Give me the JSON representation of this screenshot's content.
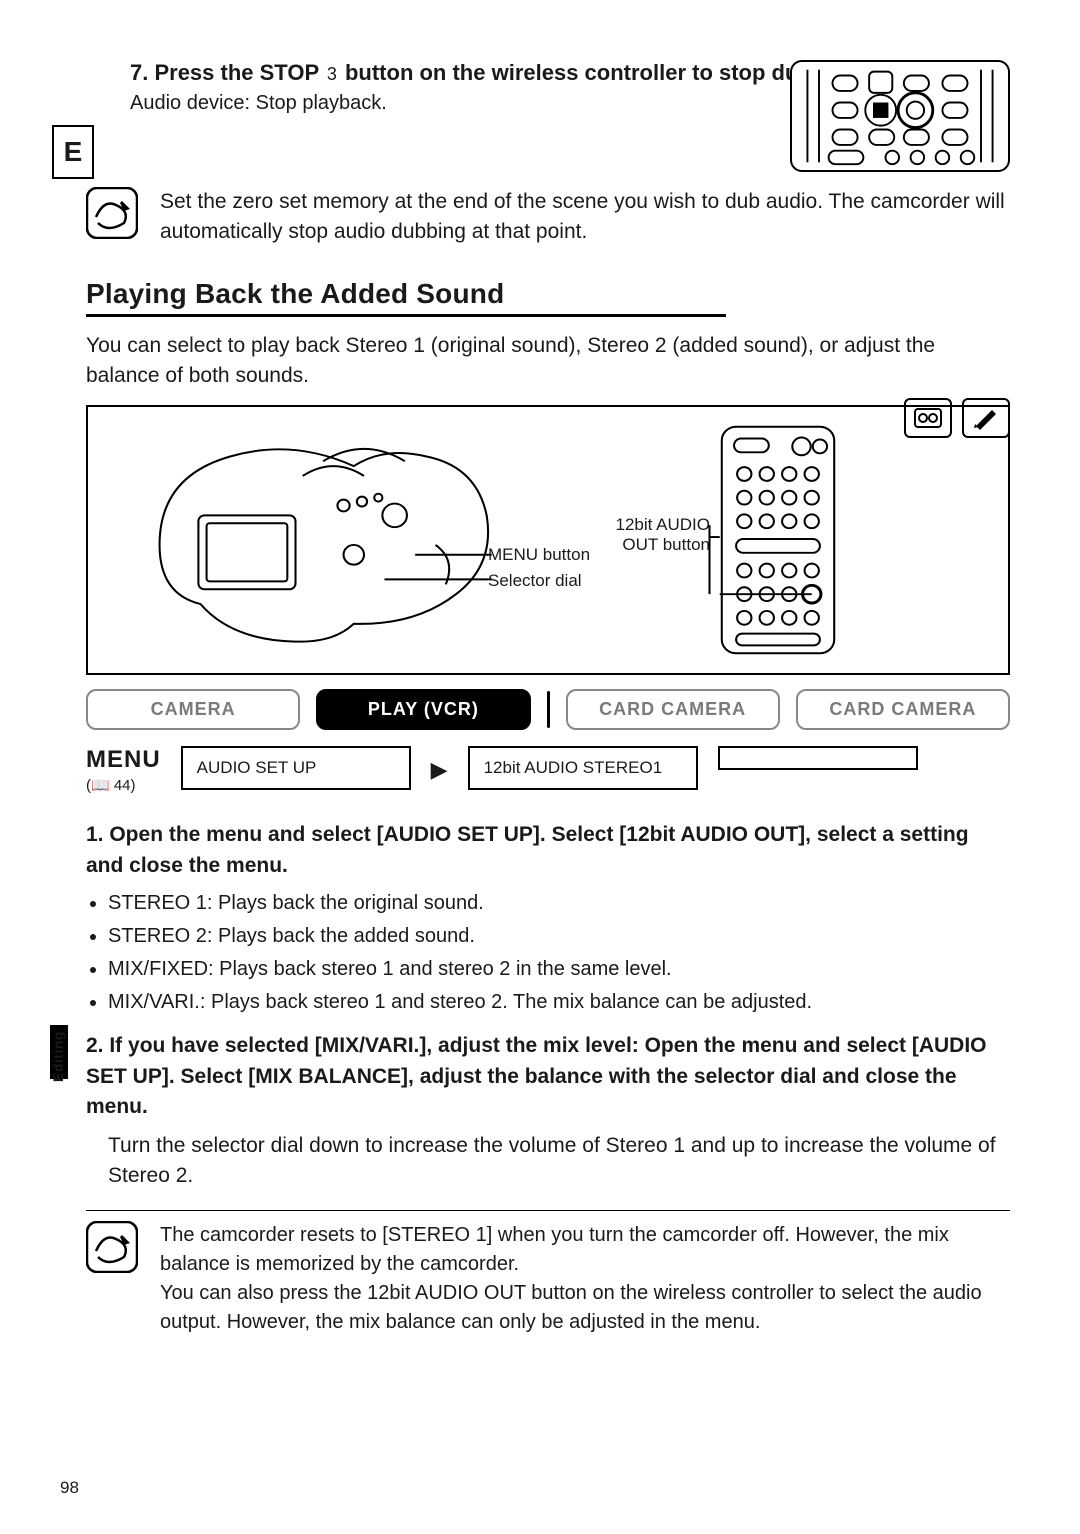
{
  "side_tab": "E",
  "step7": {
    "title_pre": "7. Press the STOP ",
    "stop_glyph": "3",
    "title_post": " button on the wireless controller to stop dubbing.",
    "sub": "Audio device: Stop playback."
  },
  "note_top": "Set the zero set memory at the end of the scene you wish to dub audio. The camcorder will automatically stop audio dubbing at that point.",
  "section_title": "Playing Back the Added Sound",
  "intro": "You can select to play back Stereo 1 (original sound), Stereo 2 (added sound), or adjust the balance of both sounds.",
  "diagram_labels": {
    "menu_button": "MENU button",
    "selector_dial": "Selector dial",
    "audio_out_button": "12bit AUDIO OUT button"
  },
  "mode_tabs": {
    "camera": "CAMERA",
    "play_vcr": "PLAY (VCR)",
    "card_camera_1": "CARD CAMERA",
    "card_camera_2": "CARD CAMERA"
  },
  "menu": {
    "label": "MENU",
    "ref_page": "44",
    "box1": "AUDIO SET UP",
    "box2": "12bit AUDIO STEREO1"
  },
  "gutter_label": "Editing",
  "steps": {
    "s1_head": "1. Open the menu and select [AUDIO SET UP]. Select [12bit AUDIO OUT], select a setting and close the menu.",
    "s1_bullets": [
      "STEREO 1: Plays back the original sound.",
      "STEREO 2: Plays back the added sound.",
      "MIX/FIXED: Plays back stereo 1 and stereo 2 in the same level.",
      "MIX/VARI.: Plays back stereo 1 and stereo 2. The mix balance can be adjusted."
    ],
    "s2_head": "2. If you have selected [MIX/VARI.], adjust the mix level: Open the menu and select [AUDIO SET UP]. Select [MIX BALANCE], adjust the balance with the selector dial and close the menu.",
    "s2_body": "Turn the selector dial down to increase the volume of Stereo 1 and up to increase the volume of Stereo 2."
  },
  "note_bottom": {
    "p1": "The camcorder resets to [STEREO 1] when you turn the camcorder off. However, the mix balance is memorized by the camcorder.",
    "p2": "You can also press the 12bit AUDIO OUT button on the wireless controller to select the audio output. However, the mix balance can only be adjusted in the menu."
  },
  "page_number": "98"
}
